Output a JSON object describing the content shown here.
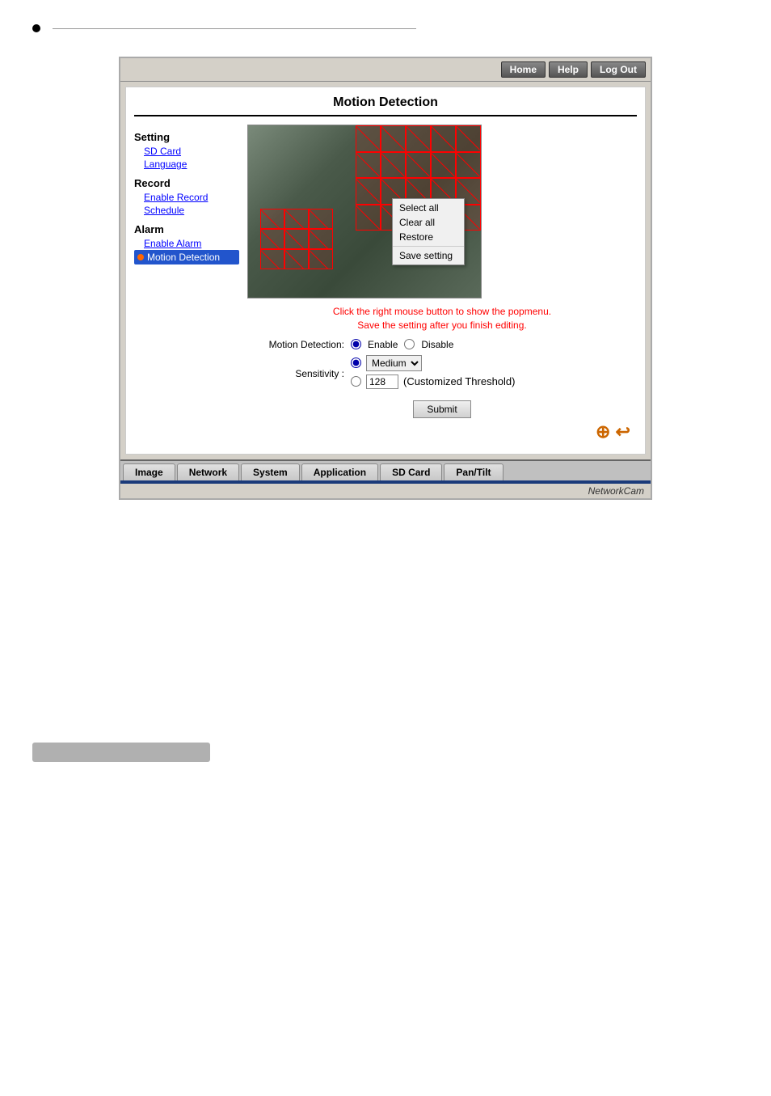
{
  "page": {
    "bullet_line": true
  },
  "header": {
    "home_label": "Home",
    "help_label": "Help",
    "logout_label": "Log Out"
  },
  "main": {
    "title": "Motion Detection",
    "sidebar": {
      "setting_label": "Setting",
      "sd_card_label": "SD Card",
      "language_label": "Language",
      "record_label": "Record",
      "enable_record_label": "Enable Record",
      "schedule_label": "Schedule",
      "alarm_label": "Alarm",
      "enable_alarm_label": "Enable Alarm",
      "motion_detection_label": "Motion Detection"
    },
    "context_menu": {
      "select_all": "Select all",
      "clear_all": "Clear all",
      "restore": "Restore",
      "save_setting": "Save setting"
    },
    "instructions": {
      "line1": "Click the right mouse button to show the popmenu.",
      "line2": "Save the setting after you finish editing."
    },
    "motion_detection": {
      "label": "Motion Detection:",
      "enable_label": "Enable",
      "disable_label": "Disable"
    },
    "sensitivity": {
      "label": "Sensitivity :",
      "medium_option": "Medium",
      "threshold_value": "128",
      "threshold_label": "(Customized Threshold)"
    },
    "submit_label": "Submit"
  },
  "bottom_tabs": [
    {
      "label": "Image"
    },
    {
      "label": "Network"
    },
    {
      "label": "System"
    },
    {
      "label": "Application"
    },
    {
      "label": "SD Card"
    },
    {
      "label": "Pan/Tilt"
    }
  ],
  "brand": "NetworkCam",
  "icons": {
    "logo": "⊕∪"
  }
}
